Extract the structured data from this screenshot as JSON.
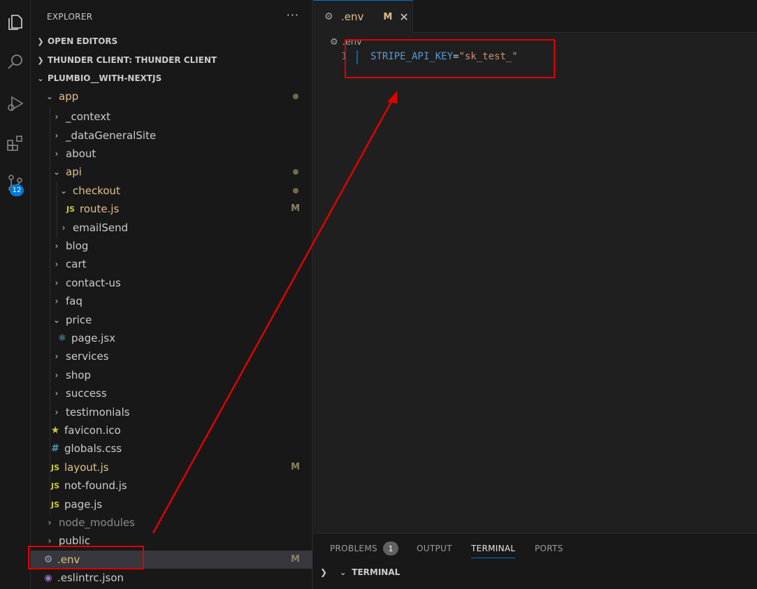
{
  "activity_bar": {
    "icons": [
      "explorer-icon",
      "search-icon",
      "run-debug-icon",
      "extensions-icon",
      "source-control-icon"
    ],
    "scm_badge": "12"
  },
  "sidebar": {
    "title": "EXPLORER",
    "more": "···",
    "sections": {
      "open_editors": "OPEN EDITORS",
      "thunder_client": "THUNDER CLIENT: THUNDER CLIENT",
      "project": "PLUMBIO__WITH-NEXTJS"
    },
    "tree": {
      "app": "app",
      "context": "_context",
      "data_general_site": "_dataGeneralSite",
      "about": "about",
      "api": "api",
      "checkout": "checkout",
      "route_js": "route.js",
      "route_js_status": "M",
      "email_send": "emailSend",
      "blog": "blog",
      "cart": "cart",
      "contact_us": "contact-us",
      "faq": "faq",
      "price": "price",
      "page_jsx": "page.jsx",
      "services": "services",
      "shop": "shop",
      "success": "success",
      "testimonials": "testimonials",
      "favicon": "favicon.ico",
      "globals_css": "globals.css",
      "layout_js": "layout.js",
      "layout_js_status": "M",
      "not_found_js": "not-found.js",
      "page_js": "page.js",
      "node_modules": "node_modules",
      "public": "public",
      "env": ".env",
      "env_status": "M",
      "eslintrc": ".eslintrc.json"
    },
    "file_icons": {
      "js": "JS",
      "css": "#",
      "star": "★"
    }
  },
  "editor": {
    "tab": {
      "label": ".env",
      "status": "M",
      "close": "✕"
    },
    "breadcrumb": ".env",
    "line_number": "1",
    "code": {
      "key": "STRIPE_API_KEY",
      "eq": "=",
      "value": "\"sk_test_\""
    }
  },
  "panel": {
    "tabs": {
      "problems": "PROBLEMS",
      "problems_count": "1",
      "output": "OUTPUT",
      "terminal": "TERMINAL",
      "ports": "PORTS"
    },
    "terminal_section": "TERMINAL"
  },
  "colors": {
    "accent": "#0078d4",
    "modified": "#e2c08d",
    "annotation_red": "#e00000"
  }
}
